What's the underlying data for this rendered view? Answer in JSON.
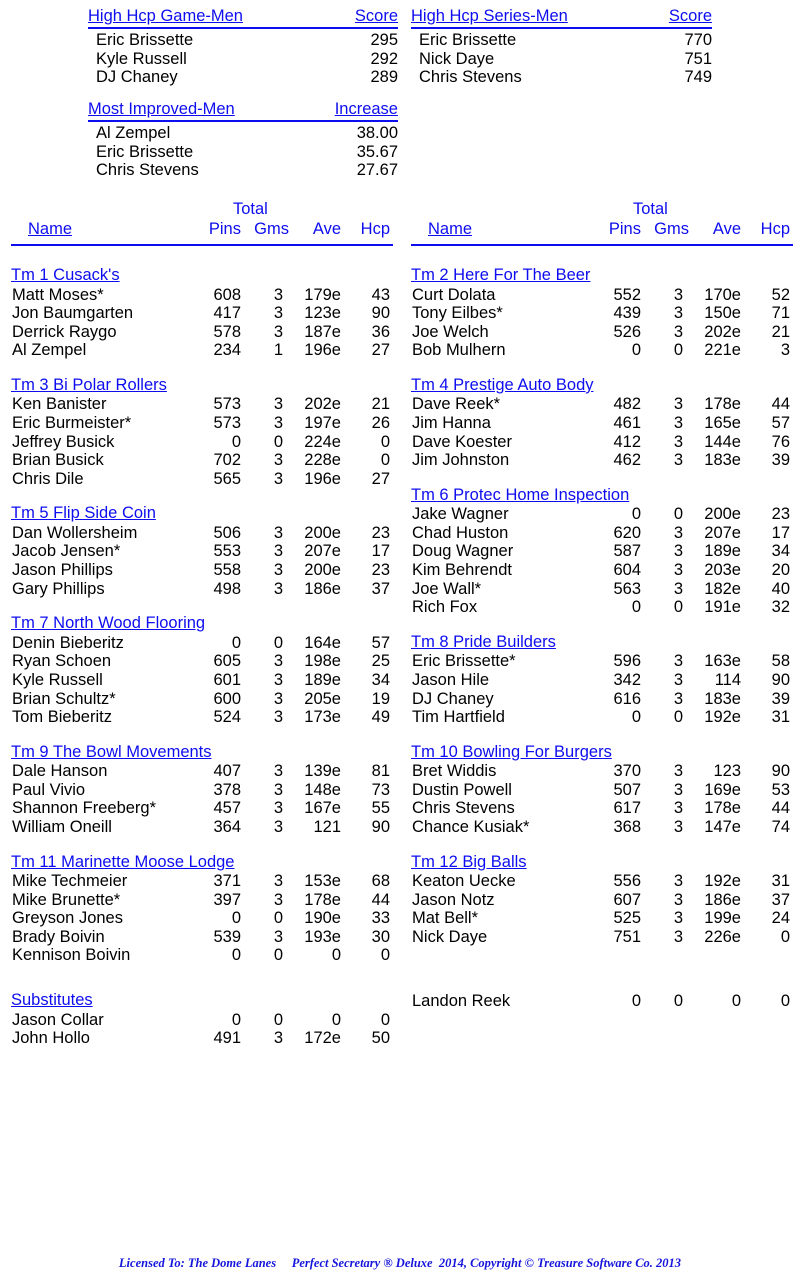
{
  "awards": [
    {
      "id": "high-hcp-game-men",
      "title": "High Hcp Game-Men",
      "metric": "Score",
      "rows": [
        {
          "name": "Eric Brissette",
          "value": "295"
        },
        {
          "name": "Kyle Russell",
          "value": "292"
        },
        {
          "name": "DJ Chaney",
          "value": "289"
        }
      ]
    },
    {
      "id": "high-hcp-series-men",
      "title": "High Hcp Series-Men",
      "metric": "Score",
      "rows": [
        {
          "name": "Eric Brissette",
          "value": "770"
        },
        {
          "name": "Nick Daye",
          "value": "751"
        },
        {
          "name": "Chris Stevens",
          "value": "749"
        }
      ]
    },
    {
      "id": "most-improved-men",
      "title": "Most Improved-Men",
      "metric": "Increase",
      "rows": [
        {
          "name": "Al Zempel",
          "value": "38.00"
        },
        {
          "name": "Eric Brissette",
          "value": "35.67"
        },
        {
          "name": "Chris Stevens",
          "value": "27.67"
        }
      ]
    }
  ],
  "roster_header": {
    "name": "Name",
    "total": "Total",
    "pins": "Pins",
    "gms": "Gms",
    "ave": "Ave",
    "hcp": "Hcp"
  },
  "left_column": {
    "teams": [
      {
        "name": "Tm 1 Cusack's",
        "players": [
          {
            "name": "Matt Moses*",
            "pins": "608",
            "gms": "3",
            "ave": "179e",
            "hcp": "43"
          },
          {
            "name": "Jon Baumgarten",
            "pins": "417",
            "gms": "3",
            "ave": "123e",
            "hcp": "90"
          },
          {
            "name": "Derrick Raygo",
            "pins": "578",
            "gms": "3",
            "ave": "187e",
            "hcp": "36"
          },
          {
            "name": "Al Zempel",
            "pins": "234",
            "gms": "1",
            "ave": "196e",
            "hcp": "27"
          }
        ]
      },
      {
        "name": "Tm 3 Bi Polar Rollers",
        "players": [
          {
            "name": "Ken Banister",
            "pins": "573",
            "gms": "3",
            "ave": "202e",
            "hcp": "21"
          },
          {
            "name": "Eric Burmeister*",
            "pins": "573",
            "gms": "3",
            "ave": "197e",
            "hcp": "26"
          },
          {
            "name": "Jeffrey Busick",
            "pins": "0",
            "gms": "0",
            "ave": "224e",
            "hcp": "0"
          },
          {
            "name": "Brian Busick",
            "pins": "702",
            "gms": "3",
            "ave": "228e",
            "hcp": "0"
          },
          {
            "name": "Chris Dile",
            "pins": "565",
            "gms": "3",
            "ave": "196e",
            "hcp": "27"
          }
        ]
      },
      {
        "name": "Tm 5 Flip Side Coin",
        "players": [
          {
            "name": "Dan Wollersheim",
            "pins": "506",
            "gms": "3",
            "ave": "200e",
            "hcp": "23"
          },
          {
            "name": "Jacob Jensen*",
            "pins": "553",
            "gms": "3",
            "ave": "207e",
            "hcp": "17"
          },
          {
            "name": "Jason Phillips",
            "pins": "558",
            "gms": "3",
            "ave": "200e",
            "hcp": "23"
          },
          {
            "name": "Gary Phillips",
            "pins": "498",
            "gms": "3",
            "ave": "186e",
            "hcp": "37"
          }
        ]
      },
      {
        "name": "Tm 7 North Wood Flooring",
        "players": [
          {
            "name": "Denin Bieberitz",
            "pins": "0",
            "gms": "0",
            "ave": "164e",
            "hcp": "57"
          },
          {
            "name": "Ryan Schoen",
            "pins": "605",
            "gms": "3",
            "ave": "198e",
            "hcp": "25"
          },
          {
            "name": "Kyle Russell",
            "pins": "601",
            "gms": "3",
            "ave": "189e",
            "hcp": "34"
          },
          {
            "name": "Brian Schultz*",
            "pins": "600",
            "gms": "3",
            "ave": "205e",
            "hcp": "19"
          },
          {
            "name": "Tom Bieberitz",
            "pins": "524",
            "gms": "3",
            "ave": "173e",
            "hcp": "49"
          }
        ]
      },
      {
        "name": "Tm 9 The Bowl Movements",
        "players": [
          {
            "name": "Dale Hanson",
            "pins": "407",
            "gms": "3",
            "ave": "139e",
            "hcp": "81"
          },
          {
            "name": "Paul Vivio",
            "pins": "378",
            "gms": "3",
            "ave": "148e",
            "hcp": "73"
          },
          {
            "name": "Shannon Freeberg*",
            "pins": "457",
            "gms": "3",
            "ave": "167e",
            "hcp": "55"
          },
          {
            "name": "William Oneill",
            "pins": "364",
            "gms": "3",
            "ave": "121",
            "hcp": "90"
          }
        ]
      },
      {
        "name": "Tm 11 Marinette Moose Lodge",
        "players": [
          {
            "name": "Mike Techmeier",
            "pins": "371",
            "gms": "3",
            "ave": "153e",
            "hcp": "68"
          },
          {
            "name": "Mike Brunette*",
            "pins": "397",
            "gms": "3",
            "ave": "178e",
            "hcp": "44"
          },
          {
            "name": "Greyson Jones",
            "pins": "0",
            "gms": "0",
            "ave": "190e",
            "hcp": "33"
          },
          {
            "name": "Brady Boivin",
            "pins": "539",
            "gms": "3",
            "ave": "193e",
            "hcp": "30"
          },
          {
            "name": "Kennison Boivin",
            "pins": "0",
            "gms": "0",
            "ave": "0",
            "hcp": "0"
          }
        ]
      }
    ],
    "substitutes": {
      "name": "Substitutes",
      "players": [
        {
          "name": "Jason Collar",
          "pins": "0",
          "gms": "0",
          "ave": "0",
          "hcp": "0"
        },
        {
          "name": "John Hollo",
          "pins": "491",
          "gms": "3",
          "ave": "172e",
          "hcp": "50"
        }
      ]
    }
  },
  "right_column": {
    "teams": [
      {
        "name": "Tm 2 Here For The Beer",
        "players": [
          {
            "name": "Curt Dolata",
            "pins": "552",
            "gms": "3",
            "ave": "170e",
            "hcp": "52"
          },
          {
            "name": "Tony Eilbes*",
            "pins": "439",
            "gms": "3",
            "ave": "150e",
            "hcp": "71"
          },
          {
            "name": "Joe Welch",
            "pins": "526",
            "gms": "3",
            "ave": "202e",
            "hcp": "21"
          },
          {
            "name": "Bob Mulhern",
            "pins": "0",
            "gms": "0",
            "ave": "221e",
            "hcp": "3"
          }
        ]
      },
      {
        "name": "Tm 4 Prestige Auto Body",
        "players": [
          {
            "name": "Dave Reek*",
            "pins": "482",
            "gms": "3",
            "ave": "178e",
            "hcp": "44"
          },
          {
            "name": "Jim Hanna",
            "pins": "461",
            "gms": "3",
            "ave": "165e",
            "hcp": "57"
          },
          {
            "name": "Dave Koester",
            "pins": "412",
            "gms": "3",
            "ave": "144e",
            "hcp": "76"
          },
          {
            "name": "Jim Johnston",
            "pins": "462",
            "gms": "3",
            "ave": "183e",
            "hcp": "39"
          }
        ]
      },
      {
        "name": "Tm 6 Protec Home Inspection",
        "players": [
          {
            "name": "Jake Wagner",
            "pins": "0",
            "gms": "0",
            "ave": "200e",
            "hcp": "23"
          },
          {
            "name": "Chad Huston",
            "pins": "620",
            "gms": "3",
            "ave": "207e",
            "hcp": "17"
          },
          {
            "name": "Doug Wagner",
            "pins": "587",
            "gms": "3",
            "ave": "189e",
            "hcp": "34"
          },
          {
            "name": "Kim Behrendt",
            "pins": "604",
            "gms": "3",
            "ave": "203e",
            "hcp": "20"
          },
          {
            "name": "Joe Wall*",
            "pins": "563",
            "gms": "3",
            "ave": "182e",
            "hcp": "40"
          },
          {
            "name": "Rich Fox",
            "pins": "0",
            "gms": "0",
            "ave": "191e",
            "hcp": "32"
          }
        ]
      },
      {
        "name": "Tm 8 Pride Builders",
        "players": [
          {
            "name": "Eric Brissette*",
            "pins": "596",
            "gms": "3",
            "ave": "163e",
            "hcp": "58"
          },
          {
            "name": "Jason Hile",
            "pins": "342",
            "gms": "3",
            "ave": "114",
            "hcp": "90"
          },
          {
            "name": "DJ Chaney",
            "pins": "616",
            "gms": "3",
            "ave": "183e",
            "hcp": "39"
          },
          {
            "name": "Tim Hartfield",
            "pins": "0",
            "gms": "0",
            "ave": "192e",
            "hcp": "31"
          }
        ]
      },
      {
        "name": "Tm 10 Bowling For Burgers",
        "players": [
          {
            "name": "Bret Widdis",
            "pins": "370",
            "gms": "3",
            "ave": "123",
            "hcp": "90"
          },
          {
            "name": "Dustin Powell",
            "pins": "507",
            "gms": "3",
            "ave": "169e",
            "hcp": "53"
          },
          {
            "name": "Chris Stevens",
            "pins": "617",
            "gms": "3",
            "ave": "178e",
            "hcp": "44"
          },
          {
            "name": "Chance Kusiak*",
            "pins": "368",
            "gms": "3",
            "ave": "147e",
            "hcp": "74"
          }
        ]
      },
      {
        "name": "Tm 12 Big Balls",
        "players": [
          {
            "name": "Keaton Uecke",
            "pins": "556",
            "gms": "3",
            "ave": "192e",
            "hcp": "31"
          },
          {
            "name": "Jason Notz",
            "pins": "607",
            "gms": "3",
            "ave": "186e",
            "hcp": "37"
          },
          {
            "name": "Mat Bell*",
            "pins": "525",
            "gms": "3",
            "ave": "199e",
            "hcp": "24"
          },
          {
            "name": "Nick Daye",
            "pins": "751",
            "gms": "3",
            "ave": "226e",
            "hcp": "0"
          }
        ]
      }
    ],
    "substitutes": {
      "name": "",
      "players": [
        {
          "name": "Landon Reek",
          "pins": "0",
          "gms": "0",
          "ave": "0",
          "hcp": "0"
        }
      ]
    }
  },
  "footer": {
    "text": "Licensed To: The Dome Lanes     Perfect Secretary ® Deluxe  2014, Copyright © Treasure Software Co. 2013"
  },
  "colors": {
    "accent_blue": "#0d0df0",
    "footer_blue": "#1414dc",
    "text_black": "#000000",
    "background": "#ffffff"
  }
}
